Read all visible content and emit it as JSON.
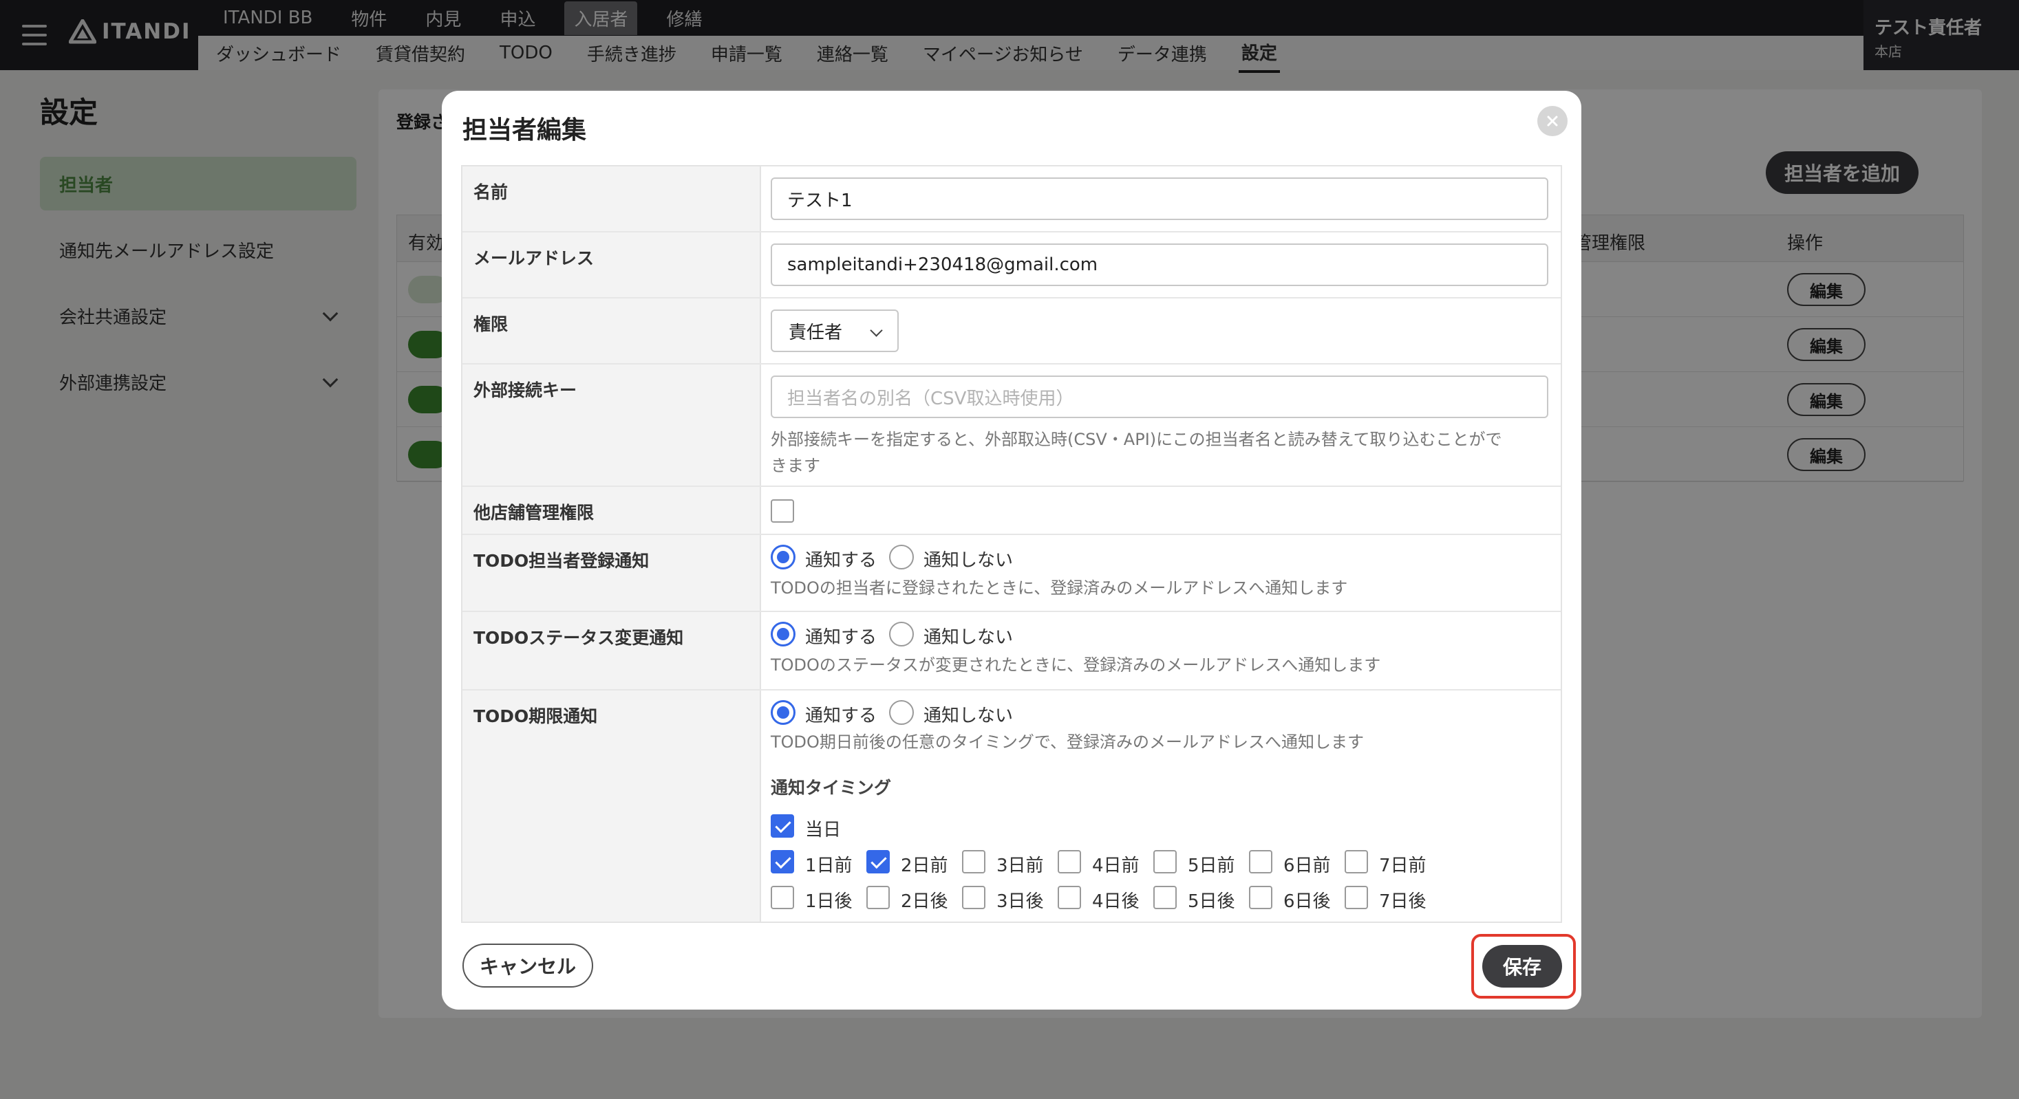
{
  "header": {
    "logo_text": "ITANDI",
    "top_tabs": [
      "ITANDI BB",
      "物件",
      "内見",
      "申込",
      "入居者",
      "修繕"
    ],
    "active_top_tab": "入居者",
    "sub_tabs": [
      "ダッシュボード",
      "賃貸借契約",
      "TODO",
      "手続き進捗",
      "申請一覧",
      "連絡一覧",
      "マイページお知らせ",
      "データ連携",
      "設定"
    ],
    "active_sub_tab": "設定",
    "user_name": "テスト責任者",
    "user_branch": "本店"
  },
  "page": {
    "title": "設定",
    "sidebar": [
      {
        "label": "担当者",
        "active": true
      },
      {
        "label": "通知先メールアドレス設定"
      },
      {
        "label": "会社共通設定",
        "expandable": true
      },
      {
        "label": "外部連携設定",
        "expandable": true
      }
    ],
    "registered_label": "登録さ",
    "add_button": "担当者を追加",
    "table_headers": {
      "enabled": "有効",
      "permission": "管理権限",
      "action": "操作"
    },
    "rows": [
      {
        "toggle_on": false,
        "edit": "編集"
      },
      {
        "toggle_on": true,
        "edit": "編集"
      },
      {
        "toggle_on": true,
        "edit": "編集"
      },
      {
        "toggle_on": true,
        "edit": "編集"
      }
    ]
  },
  "modal": {
    "title": "担当者編集",
    "fields": {
      "name": {
        "label": "名前",
        "value": "テスト1"
      },
      "email": {
        "label": "メールアドレス",
        "value": "sampleitandi+230418@gmail.com"
      },
      "role": {
        "label": "権限",
        "value": "責任者"
      },
      "external_key": {
        "label": "外部接続キー",
        "placeholder": "担当者名の別名（CSV取込時使用）",
        "help_line1": "外部接続キーを指定すると、外部取込時(CSV・API)にこの担当者名と読み替えて取り込むことがで",
        "help_line2": "きます"
      },
      "other_store": {
        "label": "他店舗管理権限",
        "checked": false
      },
      "todo_assign": {
        "label": "TODO担当者登録通知",
        "opt_on": "通知する",
        "opt_off": "通知しない",
        "selected": "通知する",
        "help": "TODOの担当者に登録されたときに、登録済みのメールアドレスへ通知します"
      },
      "todo_status": {
        "label": "TODOステータス変更通知",
        "opt_on": "通知する",
        "opt_off": "通知しない",
        "selected": "通知する",
        "help": "TODOのステータスが変更されたときに、登録済みのメールアドレスへ通知します"
      },
      "todo_deadline": {
        "label": "TODO期限通知",
        "opt_on": "通知する",
        "opt_off": "通知しない",
        "selected": "通知する",
        "help": "TODO期日前後の任意のタイミングで、登録済みのメールアドレスへ通知します",
        "timing_title": "通知タイミング",
        "same_day": {
          "label": "当日",
          "checked": true
        },
        "before": [
          {
            "label": "1日前",
            "checked": true
          },
          {
            "label": "2日前",
            "checked": true
          },
          {
            "label": "3日前",
            "checked": false
          },
          {
            "label": "4日前",
            "checked": false
          },
          {
            "label": "5日前",
            "checked": false
          },
          {
            "label": "6日前",
            "checked": false
          },
          {
            "label": "7日前",
            "checked": false
          }
        ],
        "after": [
          {
            "label": "1日後",
            "checked": false
          },
          {
            "label": "2日後",
            "checked": false
          },
          {
            "label": "3日後",
            "checked": false
          },
          {
            "label": "4日後",
            "checked": false
          },
          {
            "label": "5日後",
            "checked": false
          },
          {
            "label": "6日後",
            "checked": false
          },
          {
            "label": "7日後",
            "checked": false
          }
        ]
      }
    },
    "cancel_label": "キャンセル",
    "save_label": "保存"
  },
  "colors": {
    "accent_blue": "#3468e8",
    "highlight_red": "#e2392c",
    "active_green": "#3c8a2e"
  }
}
